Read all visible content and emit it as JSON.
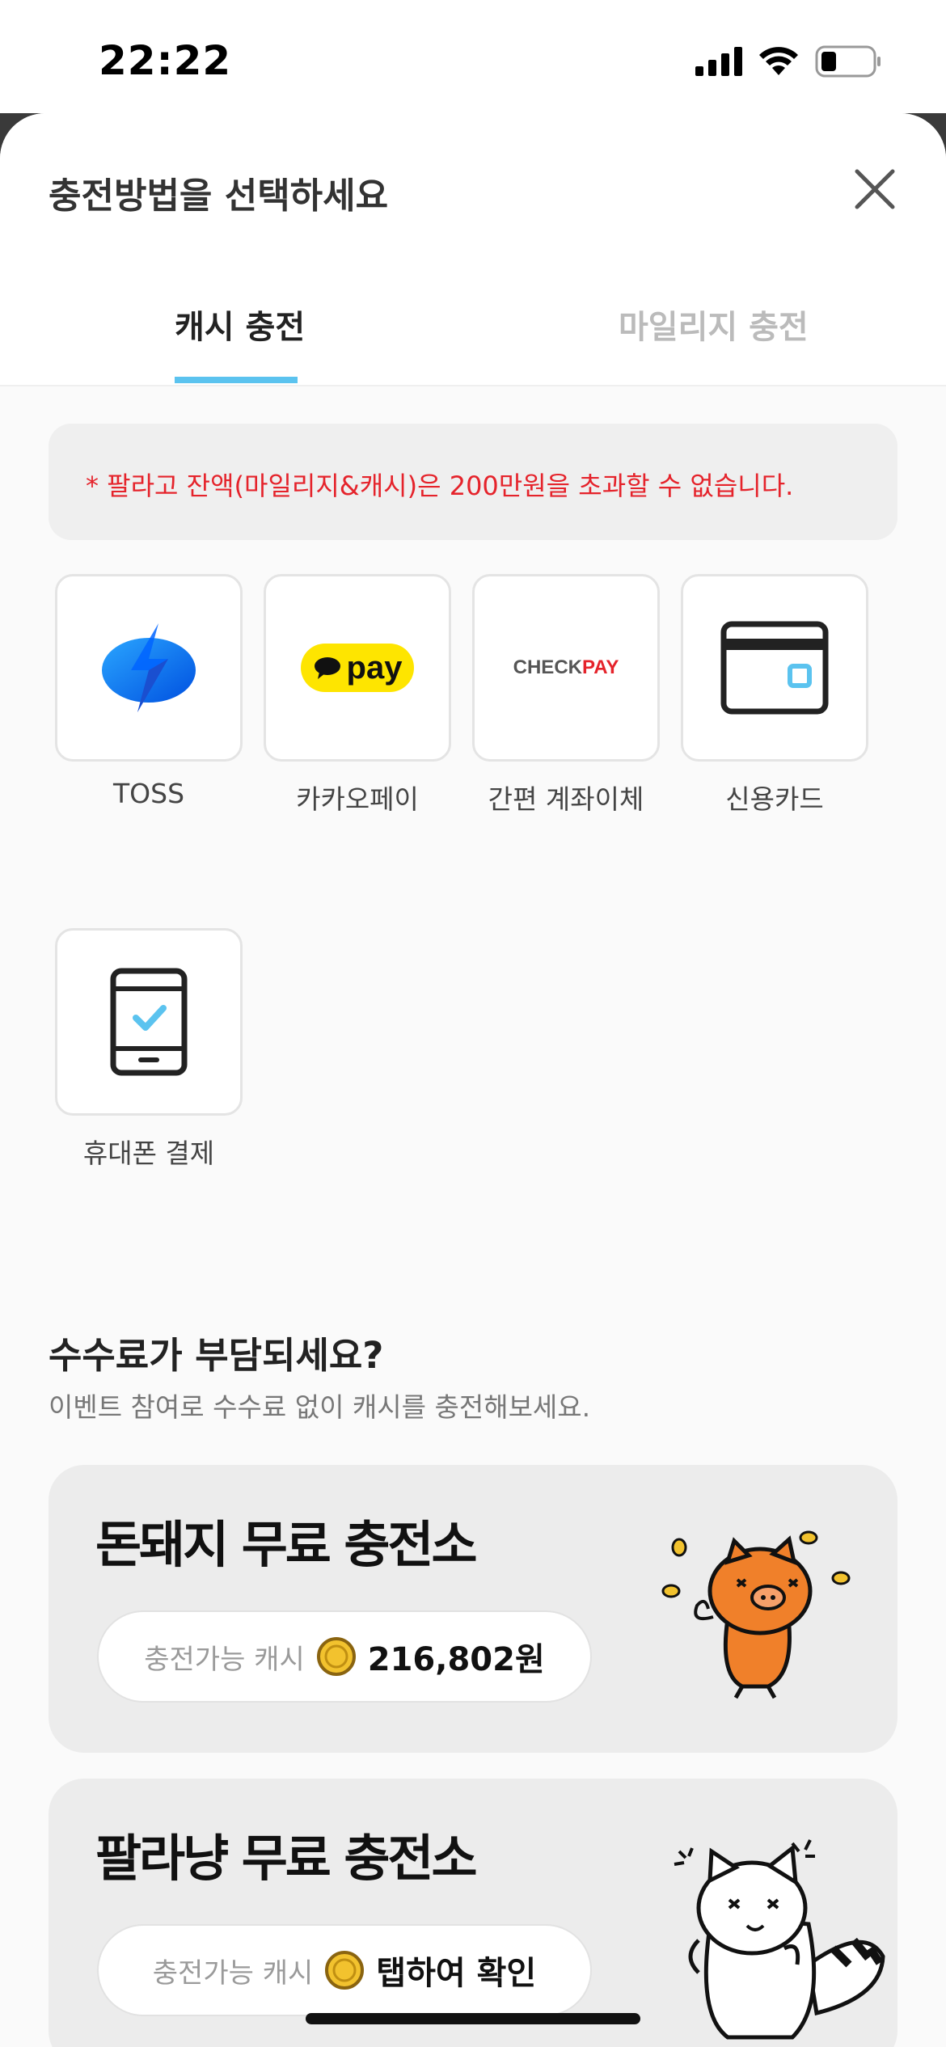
{
  "status_bar": {
    "time": "22:22"
  },
  "sheet": {
    "title": "충전방법을 선택하세요",
    "tabs": [
      {
        "label": "캐시 충전",
        "active": true
      },
      {
        "label": "마일리지 충전",
        "active": false
      }
    ],
    "notice": "* 팔라고 잔액(마일리지&캐시)은 200만원을 초과할 수 없습니다.",
    "payment_methods": [
      {
        "label": "TOSS",
        "icon": "toss-icon"
      },
      {
        "label": "카카오페이",
        "icon": "kakaopay-icon",
        "logo_text": "pay"
      },
      {
        "label": "간편 계좌이체",
        "icon": "checkpay-icon",
        "logo_text_a": "CHECK",
        "logo_text_b": "PAY"
      },
      {
        "label": "신용카드",
        "icon": "credit-card-icon"
      },
      {
        "label": "휴대폰 결제",
        "icon": "mobile-phone-icon"
      }
    ]
  },
  "fee_section": {
    "title": "수수료가 부담되세요?",
    "subtitle": "이벤트 참여로 수수료 없이 캐시를 충전해보세요."
  },
  "stations": [
    {
      "title": "돈돼지 무료 충전소",
      "pill_label": "충전가능 캐시",
      "pill_value": "216,802원",
      "mascot": "pig-icon"
    },
    {
      "title": "팔라냥 무료 충전소",
      "pill_label": "충전가능 캐시",
      "pill_value": "탭하여 확인",
      "mascot": "raccoon-cat-icon"
    }
  ],
  "colors": {
    "accent": "#5bc3ef",
    "notice_red": "#e5232b",
    "kakao_yellow": "#fee500",
    "toss_blue": "#0064ff",
    "checkpay_red": "#e5232b"
  }
}
